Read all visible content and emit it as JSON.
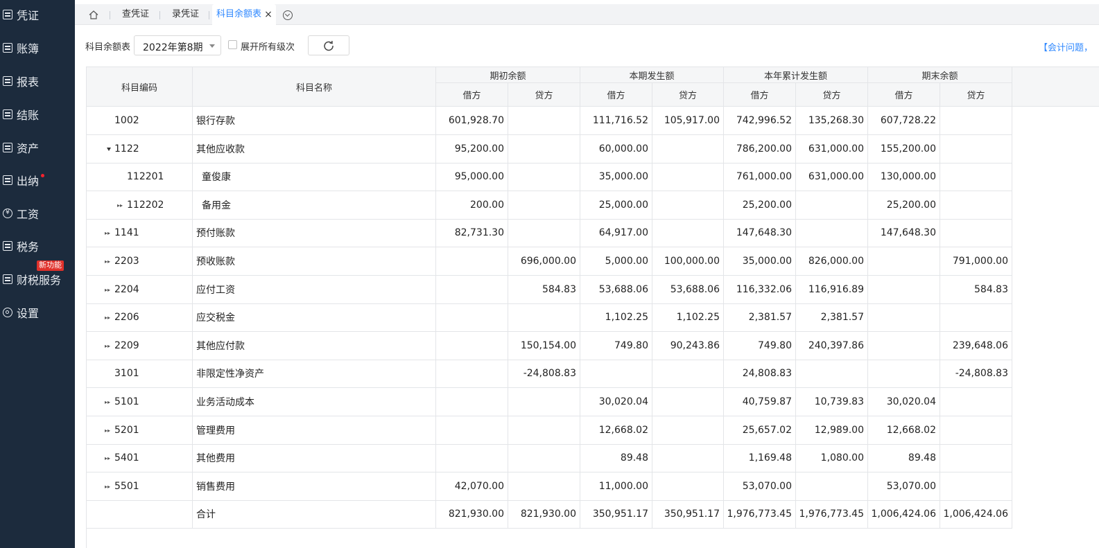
{
  "sidebar": {
    "items": [
      {
        "label": "凭证",
        "icon": "voucher-icon"
      },
      {
        "label": "账簿",
        "icon": "ledger-icon"
      },
      {
        "label": "报表",
        "icon": "report-icon"
      },
      {
        "label": "结账",
        "icon": "closing-icon"
      },
      {
        "label": "资产",
        "icon": "asset-icon"
      },
      {
        "label": "出纳",
        "icon": "cashier-icon"
      },
      {
        "label": "工资",
        "icon": "yen-icon"
      },
      {
        "label": "税务",
        "icon": "tax-icon"
      },
      {
        "label": "财税服务",
        "icon": "service-icon"
      },
      {
        "label": "设置",
        "icon": "settings-icon"
      }
    ],
    "new_badge": "新功能",
    "accent_color": "#1c2b3d"
  },
  "tabs": [
    {
      "label": "查凭证"
    },
    {
      "label": "录凭证"
    },
    {
      "label": "科目余额表",
      "active": true
    }
  ],
  "toolbar": {
    "title": "科目余额表",
    "period": "2022年第8期",
    "expand_label": "展开所有级次",
    "help_link": "【会计问题，"
  },
  "table": {
    "headers": {
      "code": "科目编码",
      "name": "科目名称",
      "groups": [
        "期初余额",
        "本期发生额",
        "本年累计发生额",
        "期末余额"
      ],
      "debit": "借方",
      "credit": "贷方"
    },
    "rows": [
      {
        "code": "1002",
        "name": "银行存款",
        "expander": "none",
        "values": [
          "601,928.70",
          "",
          "111,716.52",
          "105,917.00",
          "742,996.52",
          "135,268.30",
          "607,728.22",
          ""
        ]
      },
      {
        "code": "1122",
        "name": "其他应收款",
        "expander": "open",
        "values": [
          "95,200.00",
          "",
          "60,000.00",
          "",
          "786,200.00",
          "631,000.00",
          "155,200.00",
          ""
        ]
      },
      {
        "code": "112201",
        "name": "童俊康",
        "expander": "none",
        "child": true,
        "values": [
          "95,000.00",
          "",
          "35,000.00",
          "",
          "761,000.00",
          "631,000.00",
          "130,000.00",
          ""
        ]
      },
      {
        "code": "112202",
        "name": "备用金",
        "expander": "closed",
        "child": true,
        "values": [
          "200.00",
          "",
          "25,000.00",
          "",
          "25,200.00",
          "",
          "25,200.00",
          ""
        ]
      },
      {
        "code": "1141",
        "name": "预付账款",
        "expander": "closed",
        "values": [
          "82,731.30",
          "",
          "64,917.00",
          "",
          "147,648.30",
          "",
          "147,648.30",
          ""
        ]
      },
      {
        "code": "2203",
        "name": "预收账款",
        "expander": "closed",
        "values": [
          "",
          "696,000.00",
          "5,000.00",
          "100,000.00",
          "35,000.00",
          "826,000.00",
          "",
          "791,000.00"
        ]
      },
      {
        "code": "2204",
        "name": "应付工资",
        "expander": "closed",
        "values": [
          "",
          "584.83",
          "53,688.06",
          "53,688.06",
          "116,332.06",
          "116,916.89",
          "",
          "584.83"
        ]
      },
      {
        "code": "2206",
        "name": "应交税金",
        "expander": "closed",
        "values": [
          "",
          "",
          "1,102.25",
          "1,102.25",
          "2,381.57",
          "2,381.57",
          "",
          ""
        ]
      },
      {
        "code": "2209",
        "name": "其他应付款",
        "expander": "closed",
        "values": [
          "",
          "150,154.00",
          "749.80",
          "90,243.86",
          "749.80",
          "240,397.86",
          "",
          "239,648.06"
        ]
      },
      {
        "code": "3101",
        "name": "非限定性净资产",
        "expander": "none",
        "values": [
          "",
          "-24,808.83",
          "",
          "",
          "24,808.83",
          "",
          "",
          "-24,808.83"
        ]
      },
      {
        "code": "5101",
        "name": "业务活动成本",
        "expander": "closed",
        "values": [
          "",
          "",
          "30,020.04",
          "",
          "40,759.87",
          "10,739.83",
          "30,020.04",
          ""
        ]
      },
      {
        "code": "5201",
        "name": "管理费用",
        "expander": "closed",
        "values": [
          "",
          "",
          "12,668.02",
          "",
          "25,657.02",
          "12,989.00",
          "12,668.02",
          ""
        ]
      },
      {
        "code": "5401",
        "name": "其他费用",
        "expander": "closed",
        "values": [
          "",
          "",
          "89.48",
          "",
          "1,169.48",
          "1,080.00",
          "89.48",
          ""
        ]
      },
      {
        "code": "5501",
        "name": "销售费用",
        "expander": "closed",
        "values": [
          "42,070.00",
          "",
          "11,000.00",
          "",
          "53,070.00",
          "",
          "53,070.00",
          ""
        ]
      },
      {
        "code": "",
        "name": "合计",
        "expander": "none",
        "values": [
          "821,930.00",
          "821,930.00",
          "350,951.17",
          "350,951.17",
          "1,976,773.45",
          "1,976,773.45",
          "1,006,424.06",
          "1,006,424.06"
        ]
      }
    ]
  }
}
